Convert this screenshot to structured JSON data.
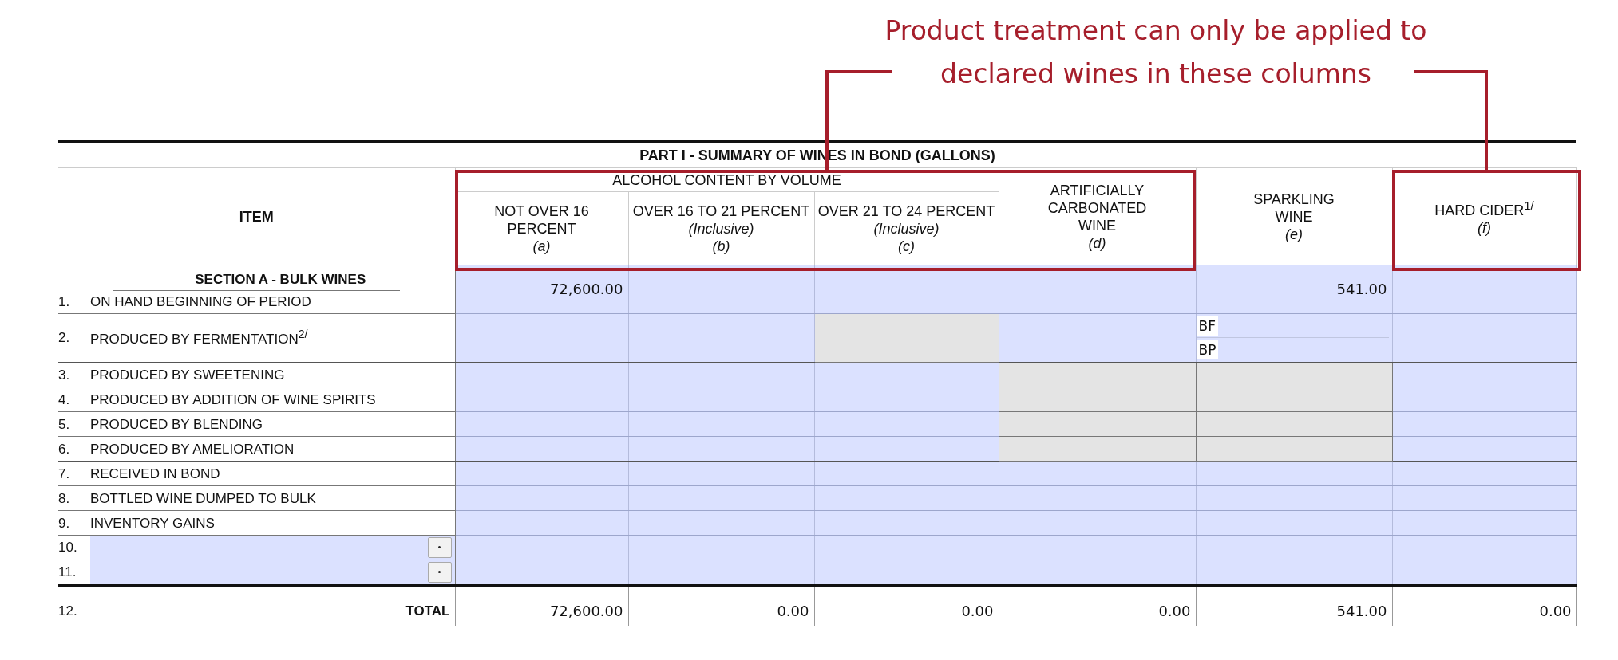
{
  "annotation": {
    "lines": [
      "Product treatment can only be applied to",
      "declared wines in these columns"
    ]
  },
  "table": {
    "title": "PART I - SUMMARY OF WINES IN BOND (GALLONS)",
    "item_header": "ITEM",
    "group_header": "ALCOHOL CONTENT BY VOLUME",
    "columns": [
      {
        "label": "NOT OVER 16 PERCENT",
        "letter": "(a)",
        "grouped": true,
        "highlighted": true
      },
      {
        "label": "OVER 16 TO 21 PERCENT",
        "qualifier": "(Inclusive)",
        "letter": "(b)",
        "grouped": true,
        "highlighted": true
      },
      {
        "label": "OVER 21 TO 24 PERCENT",
        "qualifier": "(Inclusive)",
        "letter": "(c)",
        "grouped": true,
        "highlighted": true
      },
      {
        "label": "ARTIFICIALLY CARBONATED WINE",
        "letter": "(d)",
        "grouped": false,
        "highlighted": true
      },
      {
        "label": "SPARKLING WINE",
        "letter": "(e)",
        "grouped": false,
        "highlighted": false
      },
      {
        "label": "HARD CIDER$^{1/}$",
        "letter": "(f)",
        "grouped": false,
        "highlighted": true
      }
    ],
    "section": "SECTION A - BULK WINES",
    "rows": [
      {
        "kind": "line",
        "number": "1.",
        "label": "ON HAND BEGINNING OF PERIOD",
        "cells": [
          {
            "value": "72,600.00",
            "disabled": false
          },
          {
            "disabled": false
          },
          {
            "disabled": false
          },
          {
            "disabled": false
          },
          {
            "value": "541.00",
            "disabled": false
          },
          {
            "disabled": false
          }
        ]
      },
      {
        "kind": "line",
        "number": "2.",
        "label": "PRODUCED BY FERMENTATION$^{2/}$",
        "cells": [
          {
            "disabled": false
          },
          {
            "disabled": false
          },
          {
            "disabled": true
          },
          {
            "disabled": false
          },
          {
            "disabled": false,
            "parts": [
              {
                "label": "BF"
              },
              {
                "label": "BP"
              }
            ]
          },
          {
            "disabled": false
          }
        ]
      },
      {
        "kind": "line",
        "number": "3.",
        "label": "PRODUCED BY SWEETENING",
        "cells": [
          {
            "disabled": false
          },
          {
            "disabled": false
          },
          {
            "disabled": false
          },
          {
            "disabled": true
          },
          {
            "disabled": true
          },
          {
            "disabled": false
          }
        ]
      },
      {
        "kind": "line",
        "number": "4.",
        "label": "PRODUCED BY ADDITION OF WINE SPIRITS",
        "cells": [
          {
            "disabled": false
          },
          {
            "disabled": false
          },
          {
            "disabled": false
          },
          {
            "disabled": true
          },
          {
            "disabled": true
          },
          {
            "disabled": false
          }
        ]
      },
      {
        "kind": "line",
        "number": "5.",
        "label": "PRODUCED BY BLENDING",
        "cells": [
          {
            "disabled": false
          },
          {
            "disabled": false
          },
          {
            "disabled": false
          },
          {
            "disabled": true
          },
          {
            "disabled": true
          },
          {
            "disabled": false
          }
        ]
      },
      {
        "kind": "line",
        "number": "6.",
        "label": "PRODUCED BY AMELIORATION",
        "cells": [
          {
            "disabled": false
          },
          {
            "disabled": false
          },
          {
            "disabled": false
          },
          {
            "disabled": true
          },
          {
            "disabled": true
          },
          {
            "disabled": false
          }
        ]
      },
      {
        "kind": "line",
        "number": "7.",
        "label": "RECEIVED IN BOND",
        "cells": [
          {
            "disabled": false
          },
          {
            "disabled": false
          },
          {
            "disabled": false
          },
          {
            "disabled": false
          },
          {
            "disabled": false
          },
          {
            "disabled": false
          }
        ]
      },
      {
        "kind": "line",
        "number": "8.",
        "label": "BOTTLED WINE DUMPED TO BULK",
        "cells": [
          {
            "disabled": false
          },
          {
            "disabled": false
          },
          {
            "disabled": false
          },
          {
            "disabled": false
          },
          {
            "disabled": false
          },
          {
            "disabled": false
          }
        ]
      },
      {
        "kind": "line",
        "number": "9.",
        "label": "INVENTORY GAINS",
        "cells": [
          {
            "disabled": false
          },
          {
            "disabled": false
          },
          {
            "disabled": false
          },
          {
            "disabled": false
          },
          {
            "disabled": false
          },
          {
            "disabled": false
          }
        ]
      },
      {
        "kind": "custom",
        "number": "10.",
        "cells": [
          {
            "disabled": false
          },
          {
            "disabled": false
          },
          {
            "disabled": false
          },
          {
            "disabled": false
          },
          {
            "disabled": false
          },
          {
            "disabled": false
          }
        ]
      },
      {
        "kind": "custom",
        "number": "11.",
        "cells": [
          {
            "disabled": false
          },
          {
            "disabled": false
          },
          {
            "disabled": false
          },
          {
            "disabled": false
          },
          {
            "disabled": false
          },
          {
            "disabled": false
          }
        ]
      },
      {
        "kind": "total",
        "number": "12.",
        "label": "TOTAL",
        "cells": [
          {
            "value": "72,600.00"
          },
          {
            "value": "0.00"
          },
          {
            "value": "0.00"
          },
          {
            "value": "0.00"
          },
          {
            "value": "541.00"
          },
          {
            "value": "0.00"
          }
        ]
      }
    ]
  }
}
